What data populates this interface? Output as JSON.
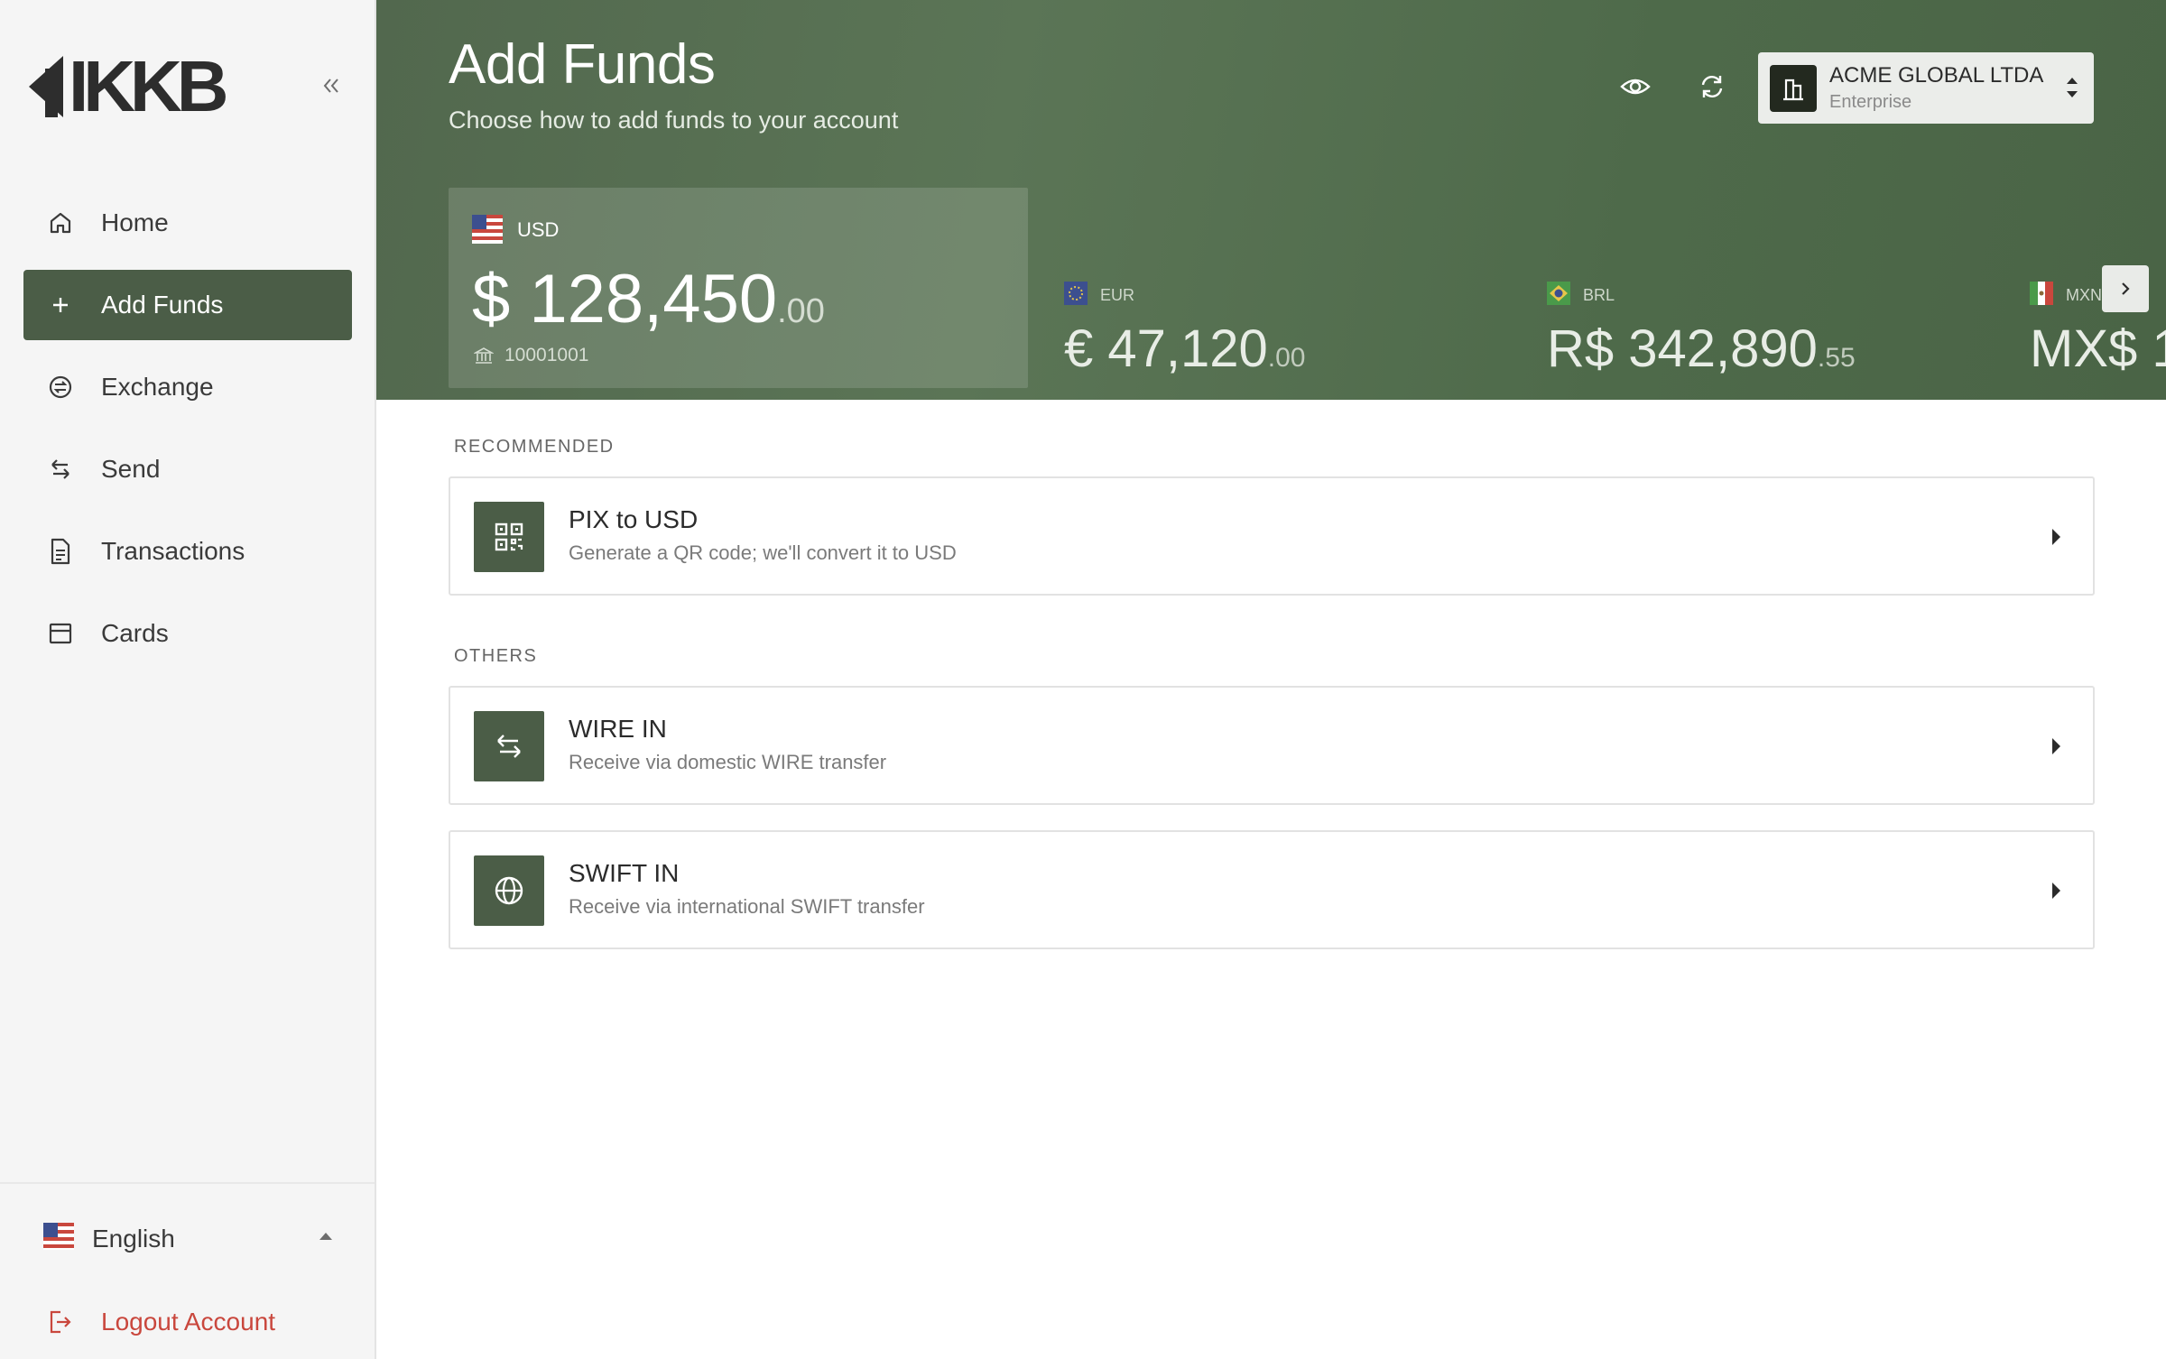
{
  "brand": {
    "name": "IKKB"
  },
  "sidebar": {
    "collapse_icon": "double-chevron-left-icon",
    "items": [
      {
        "label": "Home",
        "icon": "home-icon",
        "active": false
      },
      {
        "label": "Add Funds",
        "icon": "plus-icon",
        "active": true
      },
      {
        "label": "Exchange",
        "icon": "exchange-icon",
        "active": false
      },
      {
        "label": "Send",
        "icon": "arrows-swap-icon",
        "active": false
      },
      {
        "label": "Transactions",
        "icon": "document-icon",
        "active": false
      },
      {
        "label": "Cards",
        "icon": "card-icon",
        "active": false
      }
    ],
    "language": {
      "label": "English",
      "flag": "us-flag-icon"
    },
    "logout": {
      "label": "Logout Account",
      "icon": "logout-icon"
    }
  },
  "header": {
    "title": "Add Funds",
    "subtitle": "Choose how to add funds to your account",
    "account": {
      "name": "ACME GLOBAL LTDA",
      "type": "Enterprise"
    }
  },
  "balances": {
    "primary": {
      "code": "USD",
      "amount": "$ 128,450",
      "cents": ".00",
      "account_number": "10001001"
    },
    "others": [
      {
        "code": "EUR",
        "amount": "€ 47,120",
        "cents": ".00"
      },
      {
        "code": "BRL",
        "amount": "R$ 342,890",
        "cents": ".55"
      },
      {
        "code": "MXN",
        "amount": "MX$ 1",
        "cents": ""
      }
    ]
  },
  "sections": {
    "recommended_label": "RECOMMENDED",
    "others_label": "OTHERS"
  },
  "options": {
    "pix": {
      "title": "PIX to USD",
      "description": "Generate a QR code; we'll convert it to USD"
    },
    "wire": {
      "title": "WIRE IN",
      "description": "Receive via domestic WIRE transfer"
    },
    "swift": {
      "title": "SWIFT IN",
      "description": "Receive via international SWIFT transfer"
    }
  },
  "colors": {
    "accent": "#4b5d47",
    "header_bg": "#566f51",
    "danger": "#c9473d"
  }
}
